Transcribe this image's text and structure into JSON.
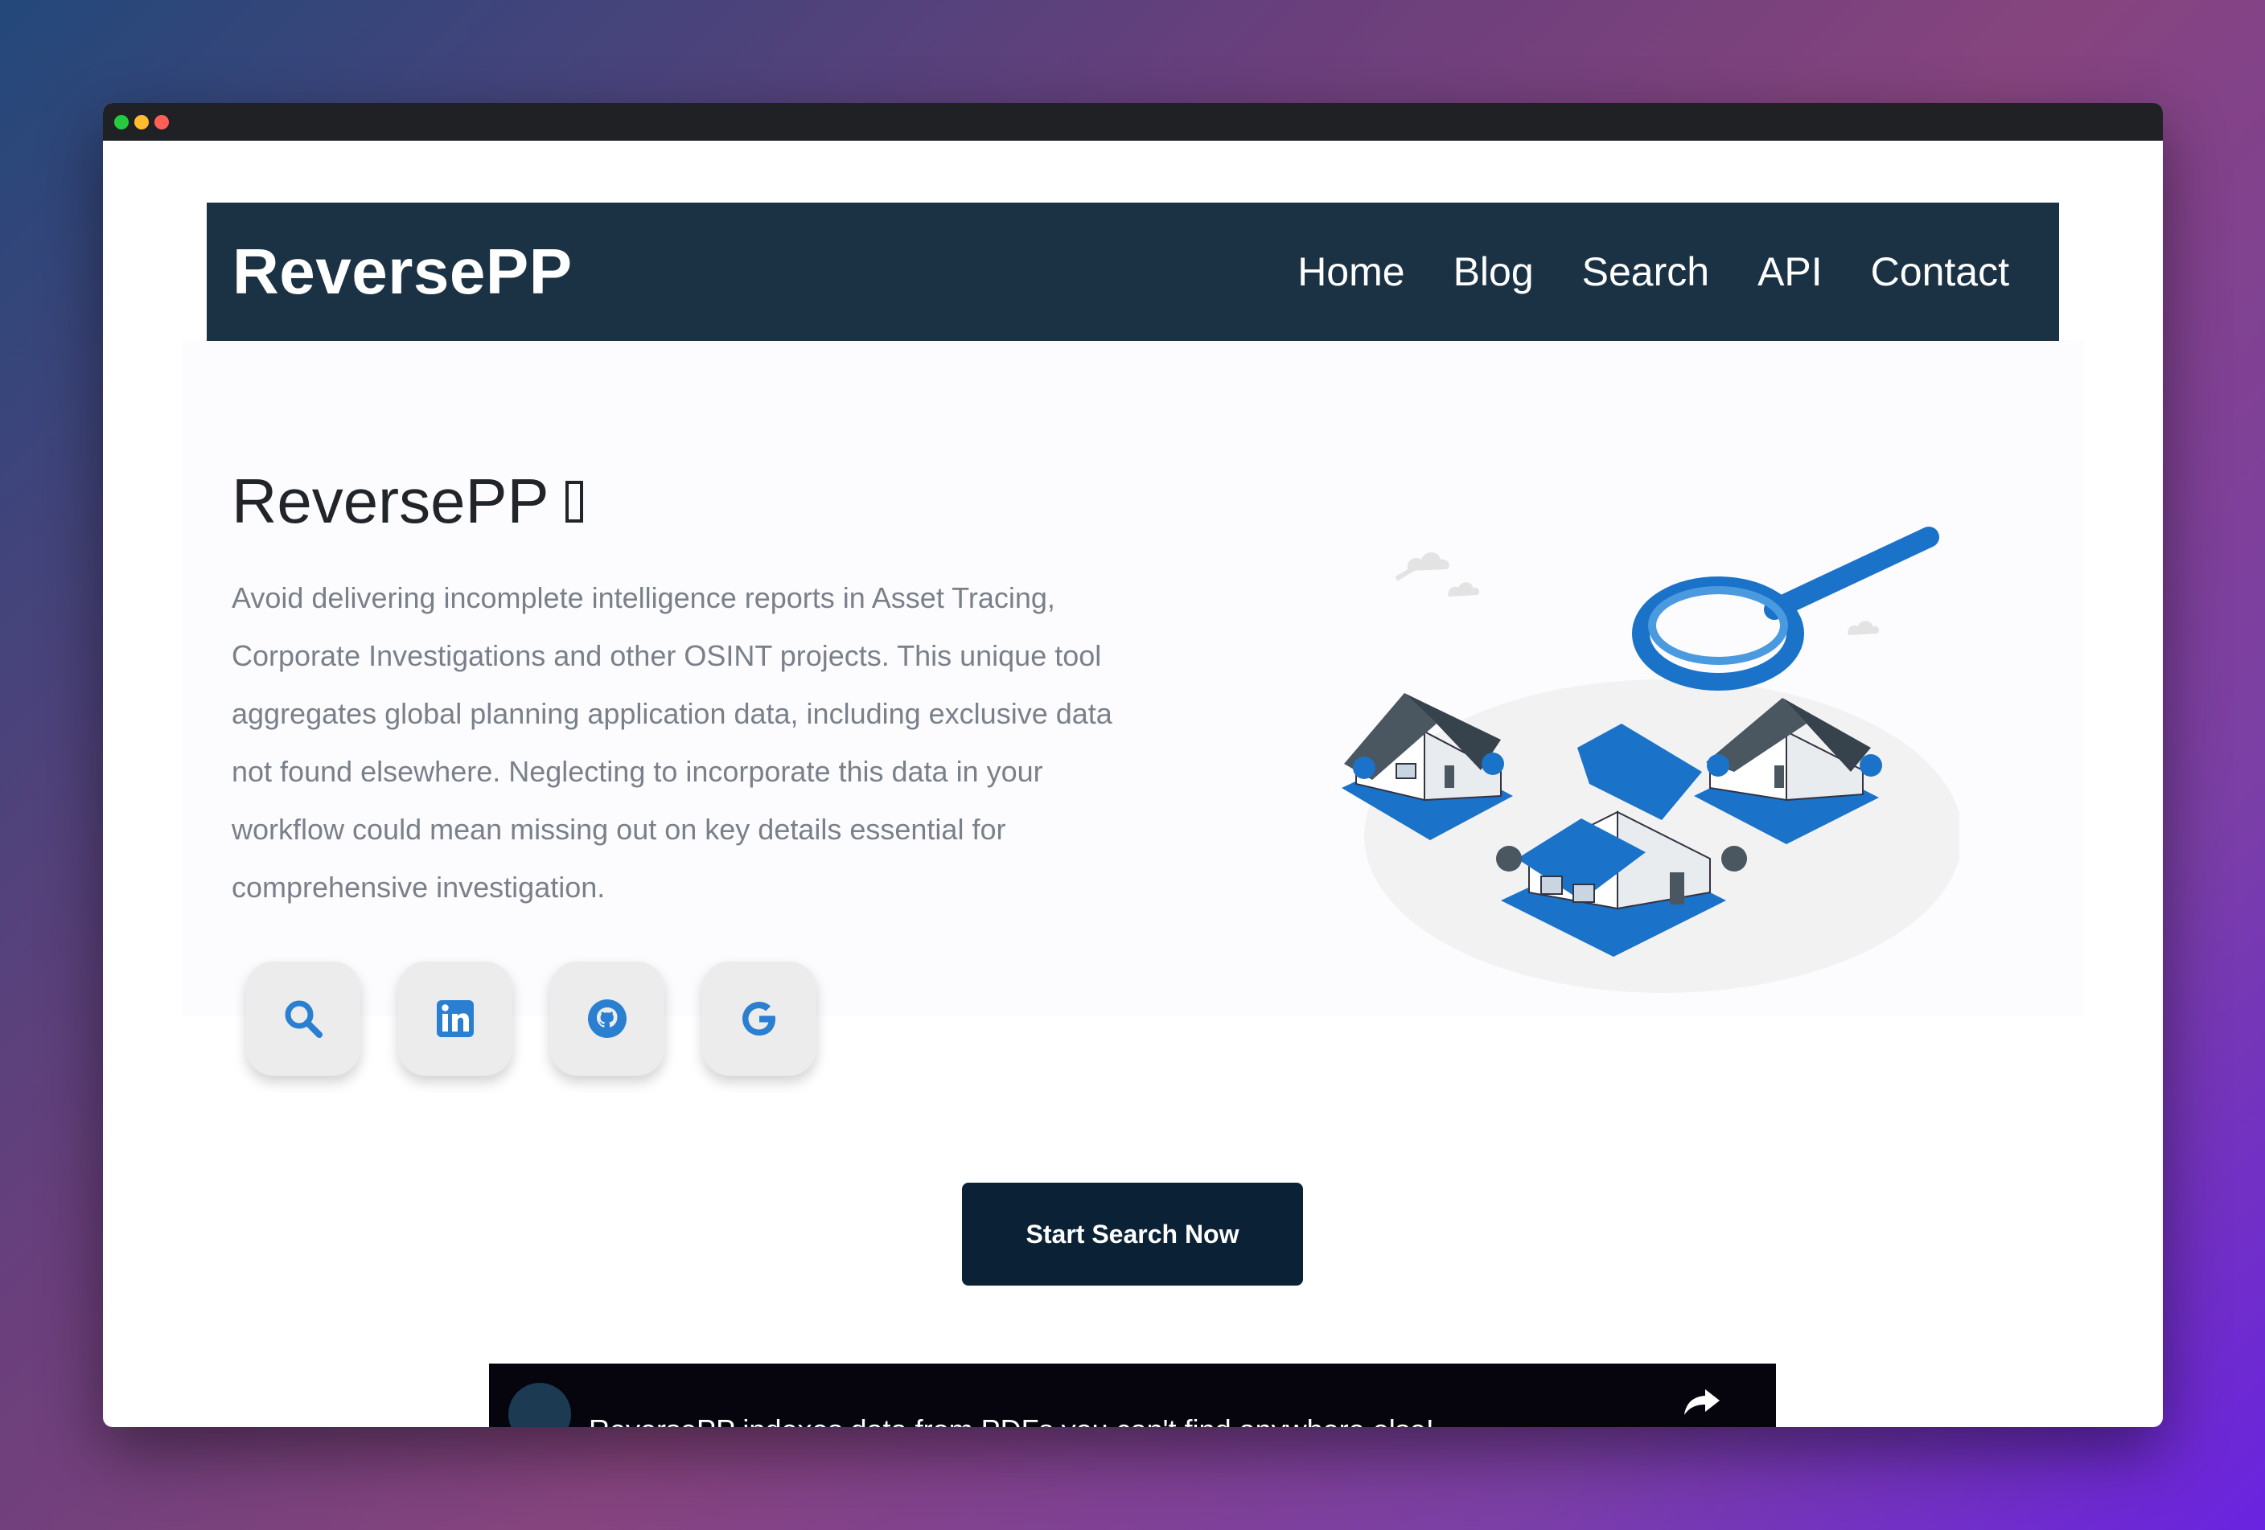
{
  "navbar": {
    "brand": "ReversePP",
    "links": [
      "Home",
      "Blog",
      "Search",
      "API",
      "Contact"
    ]
  },
  "hero": {
    "title": "ReversePP",
    "description": "Avoid delivering incomplete intelligence reports in Asset Tracing, Corporate Investigations and other OSINT projects. This unique tool aggregates global planning application data, including exclusive data not found elsewhere. Neglecting to incorporate this data in your workflow could mean missing out on key details essential for comprehensive investigation."
  },
  "social_buttons": [
    {
      "icon": "search-icon"
    },
    {
      "icon": "linkedin-icon"
    },
    {
      "icon": "github-icon"
    },
    {
      "icon": "google-icon"
    }
  ],
  "cta": {
    "label": "Start Search Now"
  },
  "video": {
    "title": "ReversePP indexes data from PDFs you can't find anywhere else!"
  },
  "colors": {
    "navbar_bg": "#1b3245",
    "cta_bg": "#0b2236",
    "accent_blue": "#2a7fd0",
    "illustration_blue": "#1a73c8"
  }
}
